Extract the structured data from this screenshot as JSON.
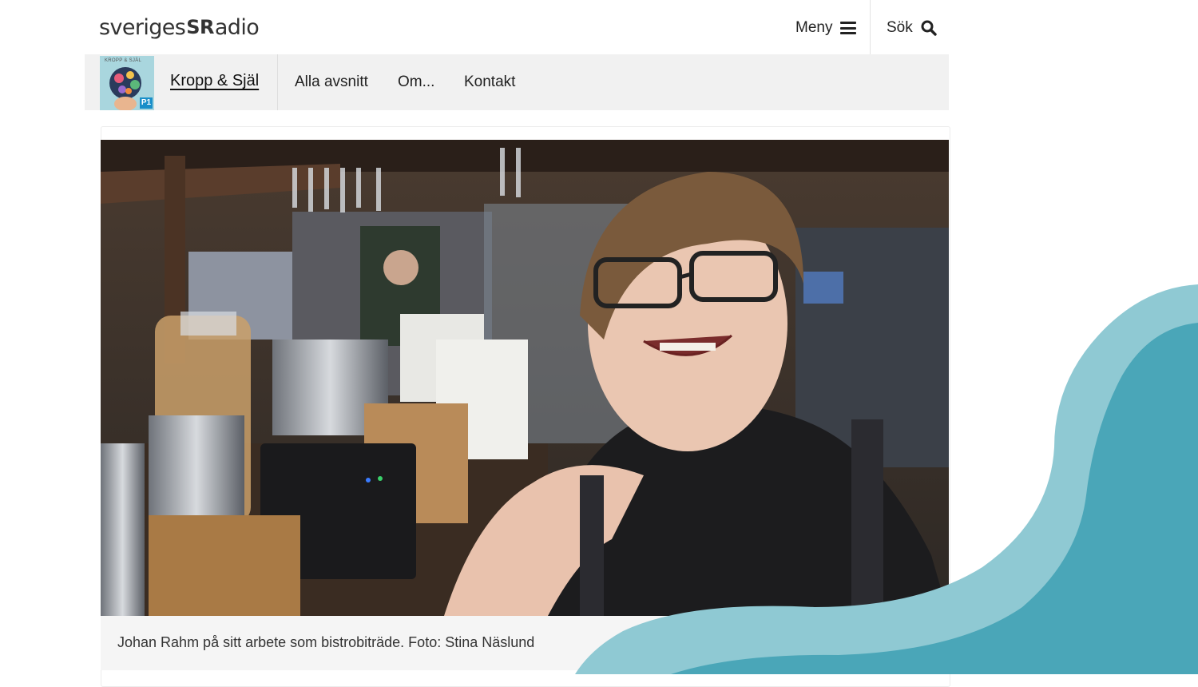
{
  "header": {
    "logo_left": "sveriges",
    "logo_mark": "SR",
    "logo_right": "adio",
    "menu_label": "Meny",
    "search_label": "Sök"
  },
  "program": {
    "title": "Kropp & Själ",
    "image_text": "KROPP & SJÄL",
    "image_badge": "P1",
    "nav": [
      "Alla avsnitt",
      "Om...",
      "Kontakt"
    ]
  },
  "article": {
    "caption": "Johan Rahm på sitt arbete som bistrobiträde. Foto: Stina Näslund"
  },
  "colors": {
    "nav_bg": "#f1f1f1",
    "caption_bg": "#f5f5f5",
    "wave_light": "#8fc9d3",
    "wave_dark": "#4aa6b8"
  }
}
